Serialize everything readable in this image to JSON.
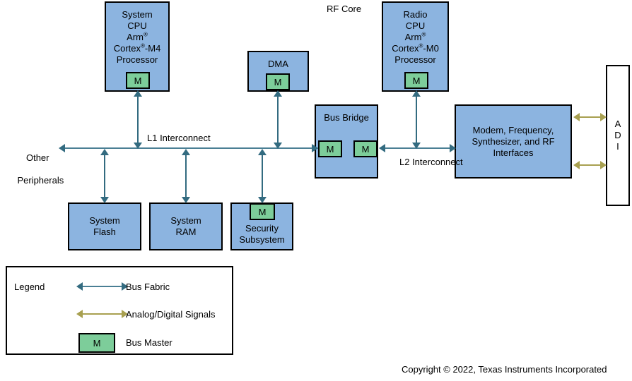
{
  "diagram": {
    "section_label": "RF Core",
    "bus_labels": {
      "l1": "L1 Interconnect",
      "l2": "L2 Interconnect"
    },
    "peripherals_label_line1": "Other",
    "peripherals_label_line2": "Peripherals",
    "master_chip_label": "M",
    "blocks": {
      "system_cpu": {
        "line1": "System",
        "line2": "CPU",
        "line3_pre": "Arm",
        "line3_sup": "®",
        "line4_pre": "Cortex",
        "line4_sup": "®",
        "line4_post": "-M4",
        "line5": "Processor"
      },
      "dma": {
        "title": "DMA"
      },
      "radio_cpu": {
        "line1": "Radio",
        "line2": "CPU",
        "line3_pre": "Arm",
        "line3_sup": "®",
        "line4_pre": "Cortex",
        "line4_sup": "®",
        "line4_post": "-M0",
        "line5": "Processor"
      },
      "bus_bridge": {
        "title": "Bus Bridge"
      },
      "modem": {
        "line1": "Modem, Frequency,",
        "line2": "Synthesizer, and RF",
        "line3": "Interfaces"
      },
      "antenna": {
        "l1": "A",
        "l2": "D",
        "l3": "I"
      },
      "system_flash": {
        "line1": "System",
        "line2": "Flash"
      },
      "system_ram": {
        "line1": "System",
        "line2": "RAM"
      },
      "security_subsystem": {
        "line1": "Security",
        "line2": "Subsystem"
      }
    }
  },
  "legend": {
    "title": "Legend",
    "items": [
      {
        "label": "Bus Fabric"
      },
      {
        "label": "Analog/Digital Signals"
      },
      {
        "label": "Bus Master"
      }
    ],
    "master_chip_label": "M"
  },
  "footer": {
    "copyright": "Copyright © 2022, Texas Instruments Incorporated"
  },
  "colors": {
    "block_fill": "#8CB4E0",
    "master_fill": "#7DCD9A",
    "bus_fabric": "#336B80",
    "analog_signal": "#A8A050",
    "outline": "#000000"
  }
}
